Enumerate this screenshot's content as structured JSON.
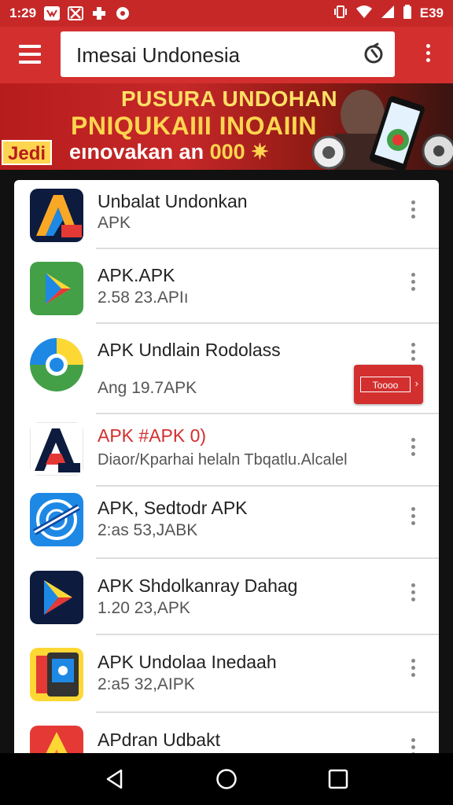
{
  "status_bar": {
    "time": "1:29",
    "battery": "E39"
  },
  "search": {
    "query": "Imesai Undonesia"
  },
  "banner": {
    "line1": "PUSURA UNDOHAN",
    "line2": "PNIQUKAIII INOAIIN",
    "badge": "Jedi",
    "line3_prefix": "eınovakan an ",
    "line3_highlight": "000 ✷"
  },
  "apps": [
    {
      "title": "Unbalat Undonkan",
      "subtitle": "APK"
    },
    {
      "title": "APK.APK",
      "subtitle": "2.58 23.APIı"
    },
    {
      "title": "APK Undlain Rodolass",
      "subtitle": "Ang 19.7APK",
      "button": "Toooo"
    },
    {
      "title": "APK #APK 0)",
      "subtitle": "Diaor/Kparhai helaln Tbqatlu.Alcalel"
    },
    {
      "title": "APK, Sedtodr APK",
      "subtitle": "2:as 53,JABK"
    },
    {
      "title": "APK Shdolkanray Dahag",
      "subtitle": "1.20 23,APK"
    },
    {
      "title": "APK Undolaa Inedaah",
      "subtitle": "2:a5 32,AIPK"
    },
    {
      "title": "APdran Udbakt",
      "subtitle": ""
    }
  ],
  "colors": {
    "status_bar": "#c62828",
    "app_bar": "#d32f2f",
    "accent": "#d32f2f"
  }
}
